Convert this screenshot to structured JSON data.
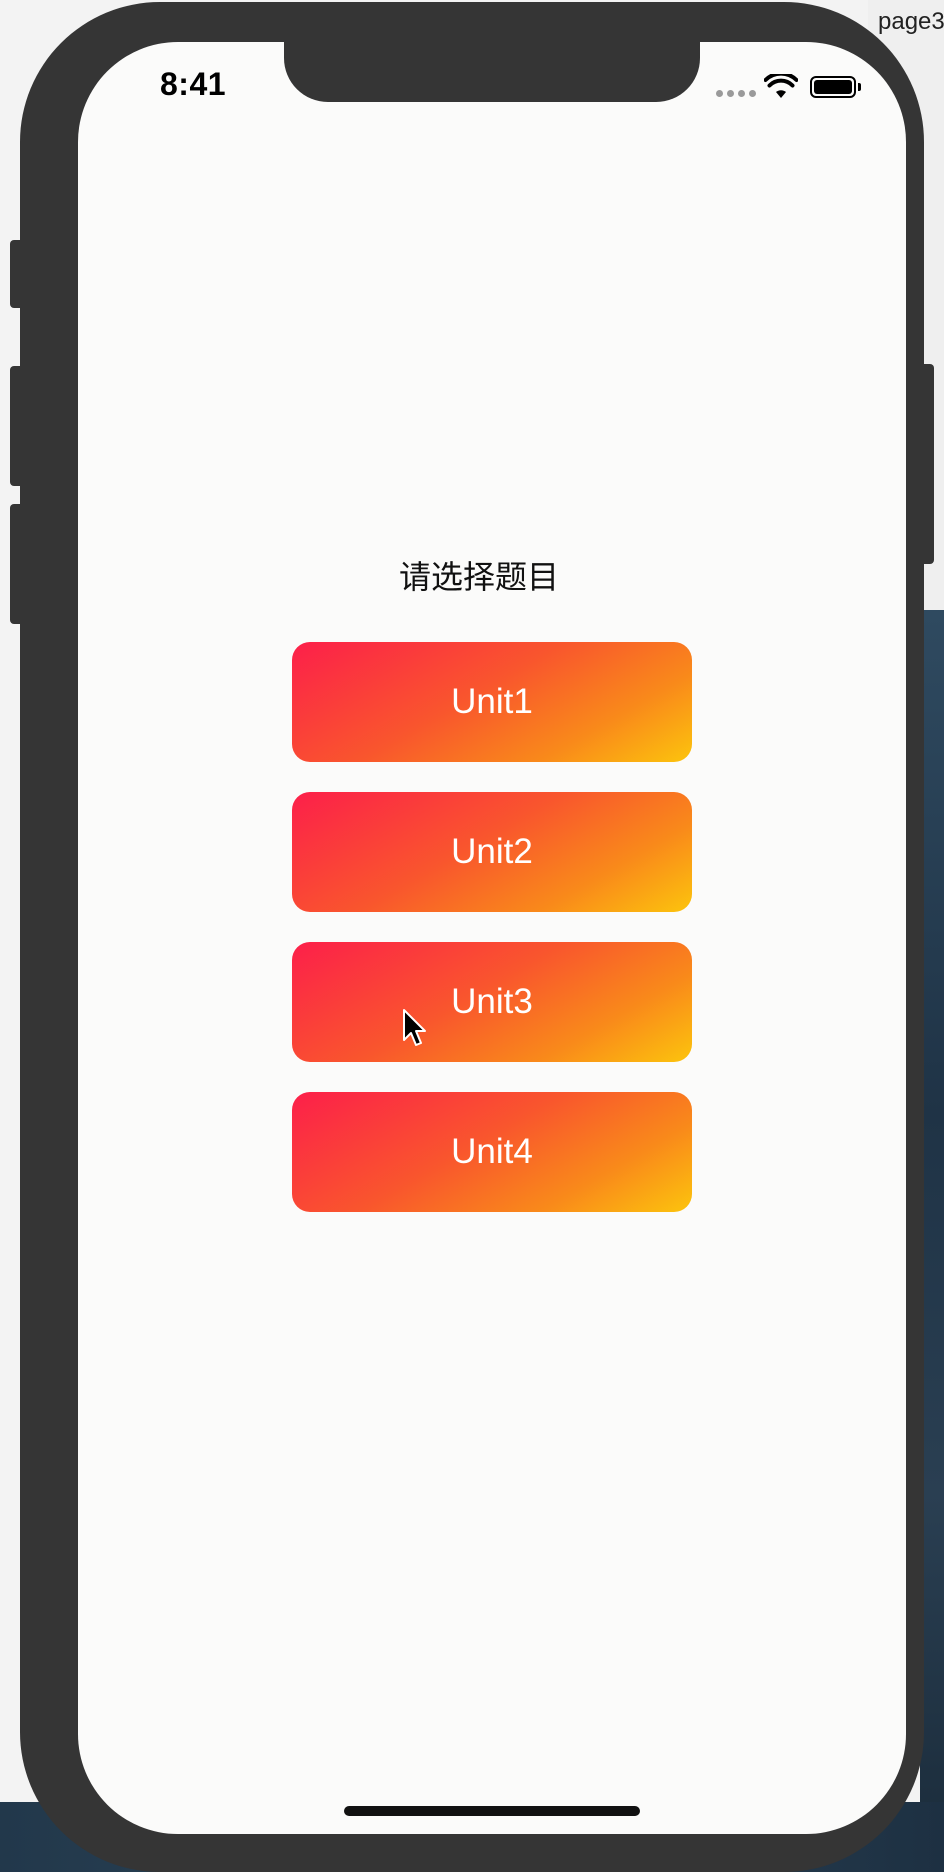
{
  "window": {
    "title": "page3"
  },
  "status_bar": {
    "time": "8:41",
    "icons": [
      "cellular-signal-icon",
      "wifi-icon",
      "battery-icon"
    ]
  },
  "page": {
    "heading": "请选择题目",
    "units": [
      {
        "label": "Unit1"
      },
      {
        "label": "Unit2"
      },
      {
        "label": "Unit3"
      },
      {
        "label": "Unit4"
      }
    ]
  },
  "colors": {
    "button_gradient_start": "#fc1f4a",
    "button_gradient_end": "#fcc40d",
    "screen_background": "#fbfbfa",
    "phone_frame": "#353535"
  }
}
